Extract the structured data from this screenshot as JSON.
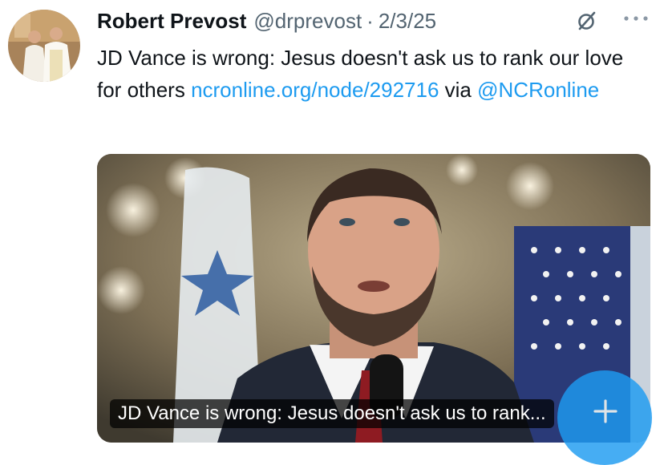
{
  "post": {
    "author_name": "Robert Prevost",
    "author_handle": "@drprevost",
    "separator": "·",
    "date": "2/3/25",
    "text": "JD Vance is wrong: Jesus doesn't ask us to rank our love for others",
    "link_text": "ncronline.org/node/292716",
    "via_label": "via",
    "via_handle": "@NCRonline"
  },
  "card": {
    "caption": "JD Vance is wrong: Jesus doesn't ask us to rank..."
  },
  "icons": {
    "avatar": "avatar-photo",
    "vpn": "slashed-circle-icon",
    "more": "more-icon",
    "compose": "plus-icon"
  },
  "colors": {
    "text": "#0f1419",
    "secondary": "#536471",
    "link": "#1d9bf0"
  }
}
